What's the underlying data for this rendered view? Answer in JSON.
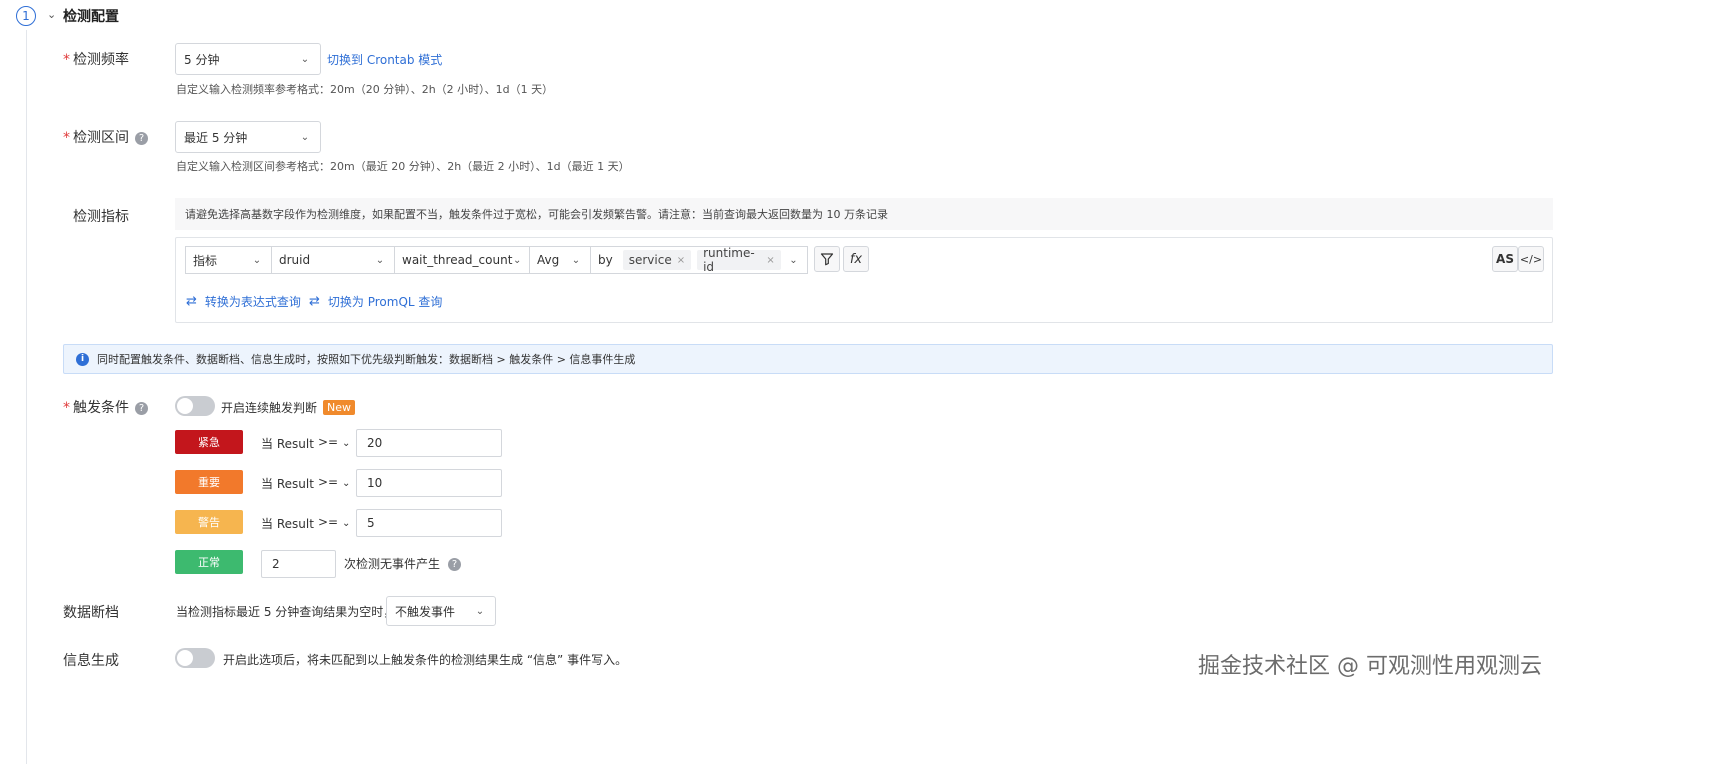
{
  "section": {
    "step": "1",
    "title": "检测配置"
  },
  "frequency": {
    "label": "检测频率",
    "required_mark": "*",
    "value": "5 分钟",
    "switch_link": "切换到 Crontab 模式",
    "hint": "自定义输入检测频率参考格式：20m（20 分钟）、2h（2 小时）、1d（1 天）"
  },
  "interval": {
    "label": "检测区间",
    "required_mark": "*",
    "value": "最近 5 分钟",
    "hint": "自定义输入检测区间参考格式：20m（最近 20 分钟）、2h（最近 2 小时）、1d（最近 1 天）"
  },
  "metric": {
    "label": "检测指标",
    "warning": "请避免选择高基数字段作为检测维度，如果配置不当，触发条件过于宽松，可能会引发频繁告警。请注意：当前查询最大返回数量为 10 万条记录",
    "query": {
      "type": "指标",
      "source": "druid",
      "field": "wait_thread_count",
      "agg": "Avg",
      "by_label": "by",
      "group_tags": [
        "service",
        "runtime-id"
      ],
      "tag_close": "×",
      "filter_icon": "filter-icon",
      "fx_label": "fx",
      "as_label": "AS",
      "code_label": "</>"
    },
    "convert_expr": "转换为表达式查询",
    "switch_promql": "切换为 PromQL 查询"
  },
  "info": {
    "icon": "i",
    "text": "同时配置触发条件、数据断档、信息生成时，按照如下优先级判断触发：数据断档 > 触发条件 > 信息事件生成"
  },
  "trigger": {
    "label": "触发条件",
    "required_mark": "*",
    "toggle_label": "开启连续触发判断",
    "new_badge": "New",
    "rules": [
      {
        "severity": "紧急",
        "color": "#c3161c",
        "cond": "当 Result",
        "op": ">=",
        "value": "20"
      },
      {
        "severity": "重要",
        "color": "#f2792b",
        "cond": "当 Result",
        "op": ">=",
        "value": "10"
      },
      {
        "severity": "警告",
        "color": "#f6b54f",
        "cond": "当 Result",
        "op": ">=",
        "value": "5"
      }
    ],
    "normal": {
      "severity": "正常",
      "color": "#3dba6f",
      "value": "2",
      "suffix": "次检测无事件产生"
    }
  },
  "nodata": {
    "label": "数据断档",
    "text": "当检测指标最近 5 分钟查询结果为空时，",
    "value": "不触发事件"
  },
  "infogen": {
    "label": "信息生成",
    "text": "开启此选项后，将未匹配到以上触发条件的检测结果生成 “信息” 事件写入。"
  },
  "watermark": "掘金技术社区 @ 可观测性用观测云"
}
